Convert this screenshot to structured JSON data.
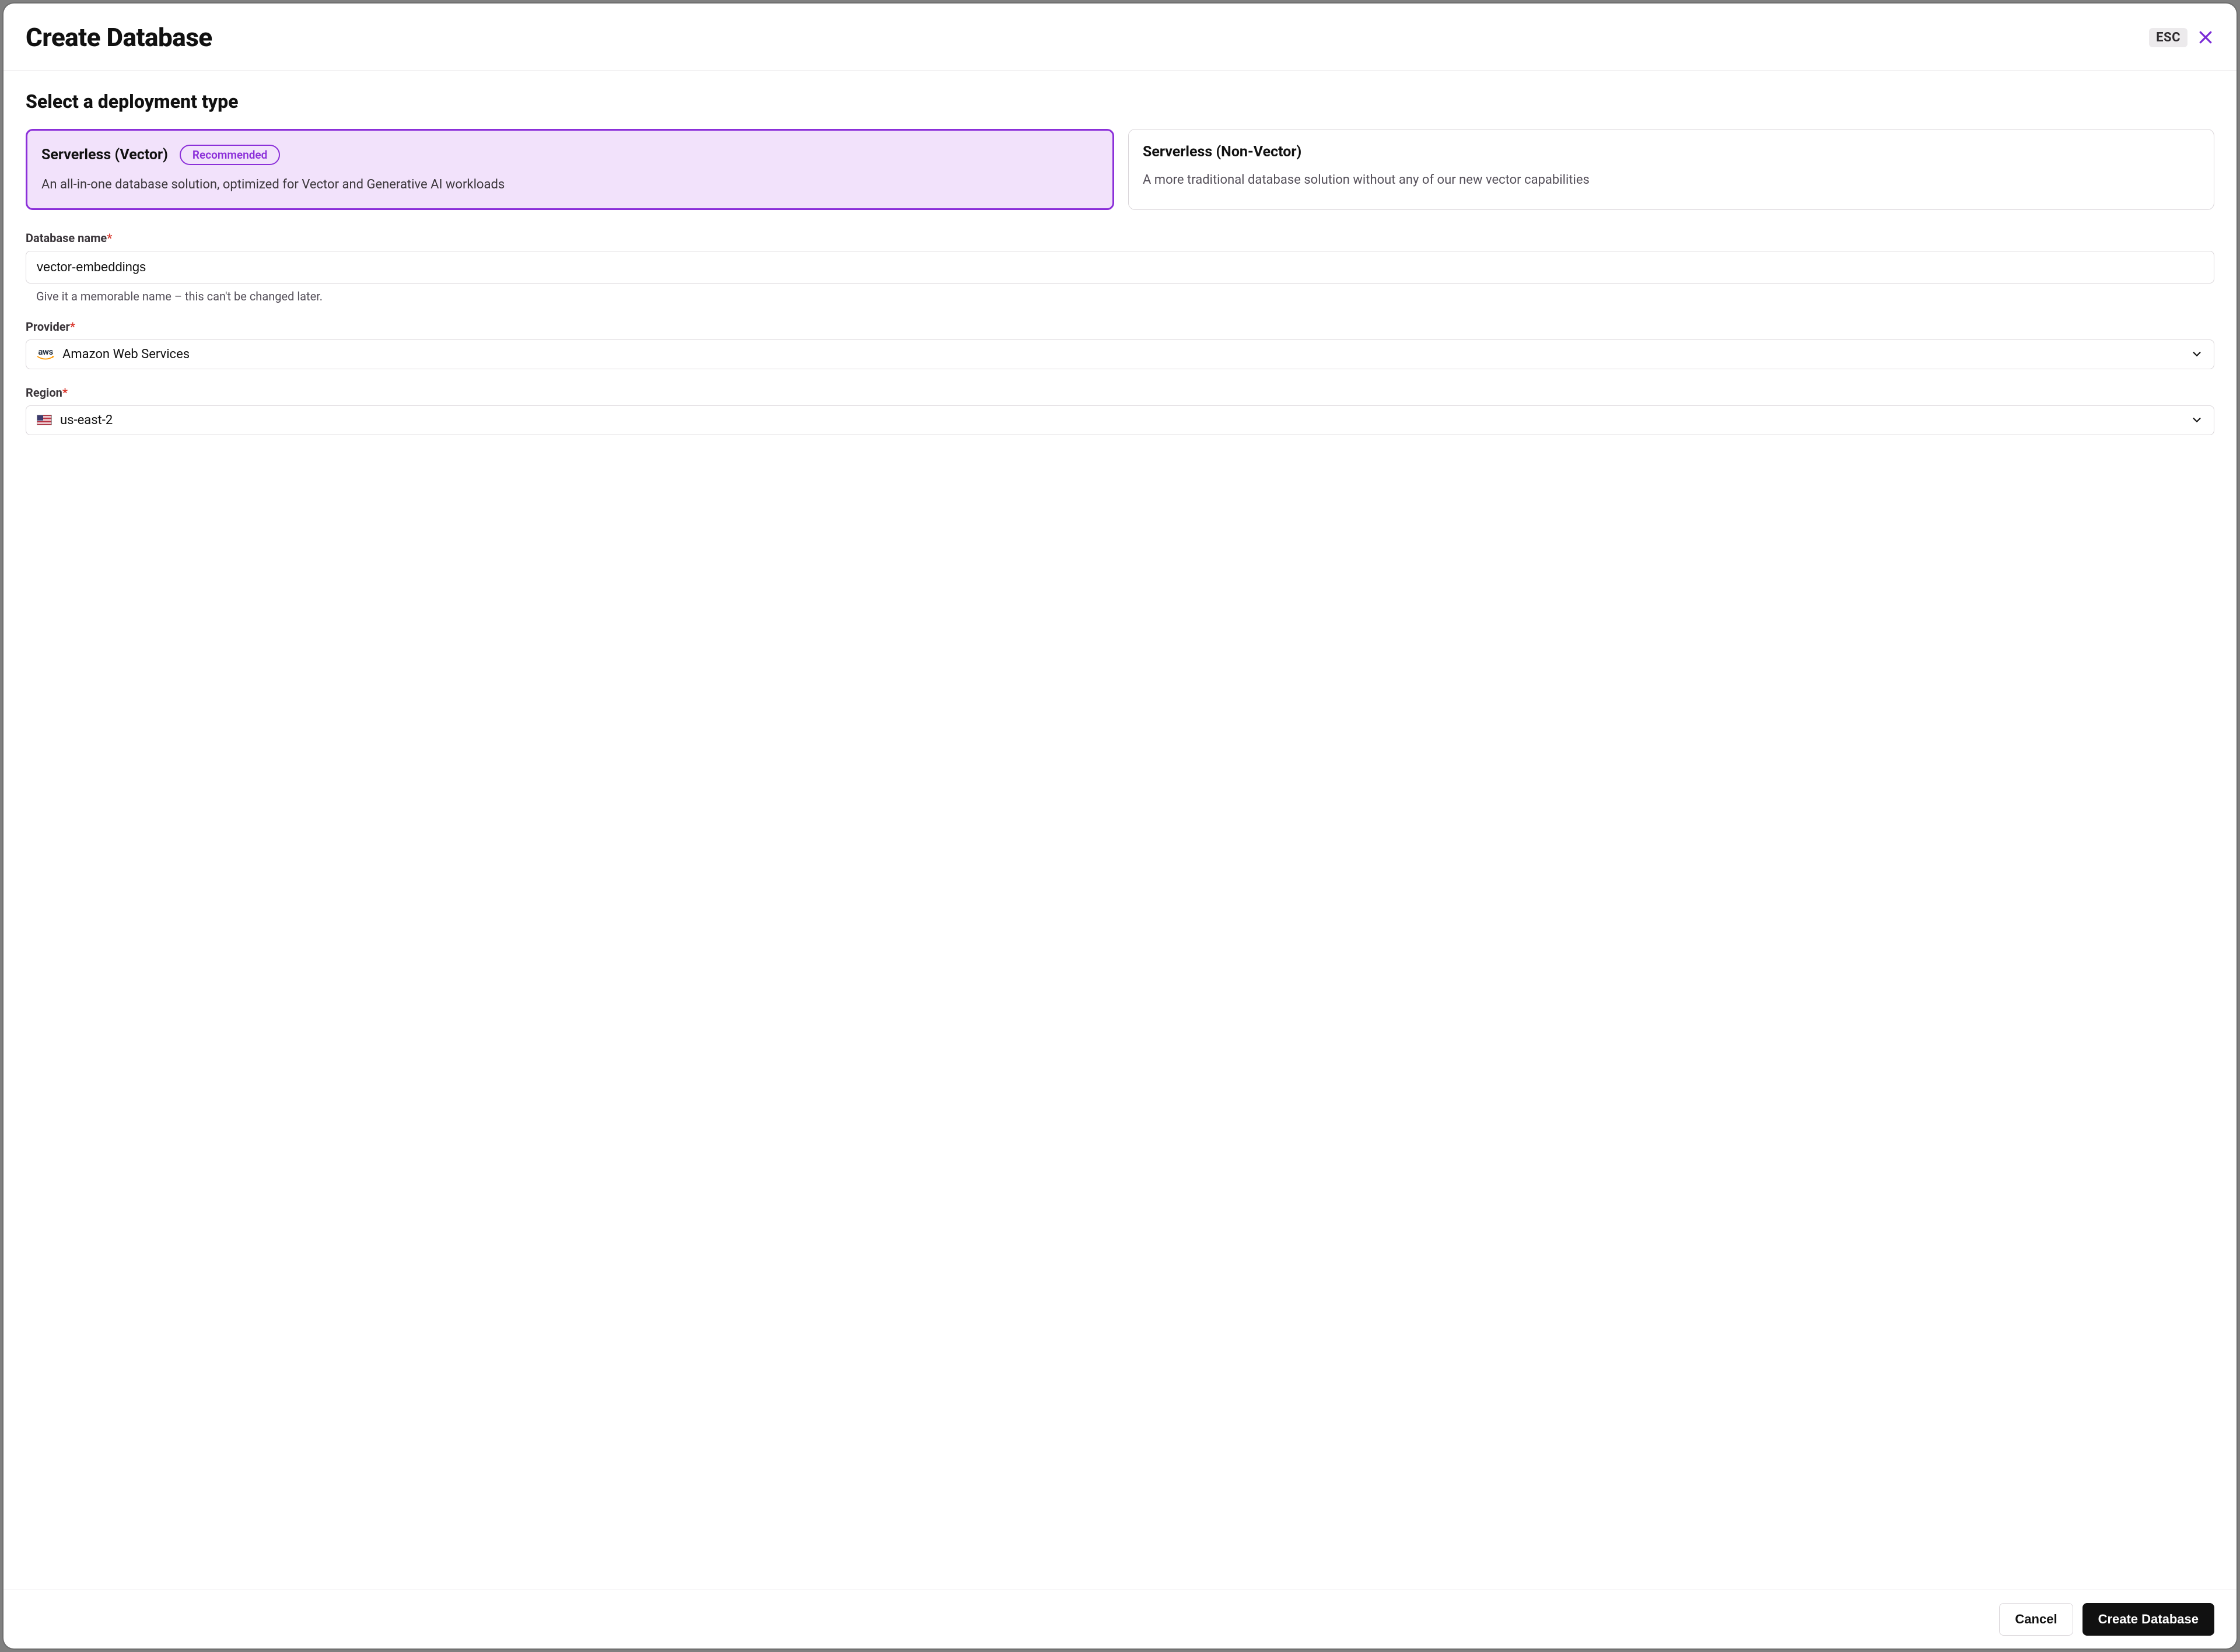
{
  "header": {
    "title": "Create Database",
    "esc_label": "ESC"
  },
  "section_title": "Select a deployment type",
  "deployment_cards": [
    {
      "title": "Serverless (Vector)",
      "badge": "Recommended",
      "description": "An all-in-one database solution, optimized for Vector and Generative AI workloads",
      "selected": true
    },
    {
      "title": "Serverless (Non-Vector)",
      "badge": null,
      "description": "A more traditional database solution without any of our new vector capabilities",
      "selected": false
    }
  ],
  "fields": {
    "db_name": {
      "label": "Database name",
      "value": "vector-embeddings",
      "help": "Give it a memorable name – this can't be changed later."
    },
    "provider": {
      "label": "Provider",
      "icon": "aws",
      "value": "Amazon Web Services"
    },
    "region": {
      "label": "Region",
      "flag": "us",
      "value": "us-east-2"
    }
  },
  "footer": {
    "cancel": "Cancel",
    "submit": "Create Database"
  }
}
